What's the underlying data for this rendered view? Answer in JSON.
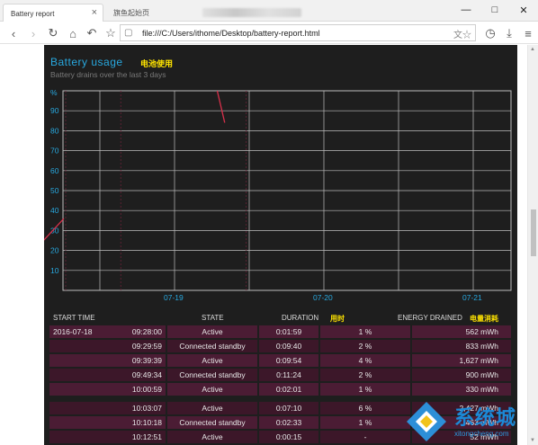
{
  "browser": {
    "active_tab": "Battery report",
    "inactive_tab": "旗鱼起始页",
    "address": "file:///C:/Users/ithome/Desktop/battery-report.html"
  },
  "section": {
    "title": "Battery usage",
    "title_cn": "电池使用",
    "subtitle": "Battery drains over the last 3 days"
  },
  "chart_data": {
    "type": "line",
    "ylabel": "%",
    "yticks": [
      "90",
      "80",
      "70",
      "60",
      "50",
      "40",
      "30",
      "20",
      "10"
    ],
    "ylim": [
      0,
      100
    ],
    "xticks": [
      "07-19",
      "07-20",
      "07-21"
    ],
    "grid": true,
    "series": [
      {
        "x": [
          0.0,
          0.03
        ],
        "y": [
          36,
          18
        ]
      },
      {
        "x": [
          1.28,
          1.33
        ],
        "y": [
          100,
          84
        ]
      }
    ]
  },
  "table": {
    "headers": {
      "start": "START TIME",
      "state": "STATE",
      "duration": "DURATION",
      "duration_cn": "用时",
      "energy": "ENERGY DRAINED",
      "energy_cn": "电量消耗"
    },
    "rows": [
      {
        "date": "2016-07-18",
        "time": "09:28:00",
        "state": "Active",
        "duration": "0:01:59",
        "pct": "1 %",
        "mwh": "562 mWh"
      },
      {
        "date": "",
        "time": "09:29:59",
        "state": "Connected standby",
        "duration": "0:09:40",
        "pct": "2 %",
        "mwh": "833 mWh"
      },
      {
        "date": "",
        "time": "09:39:39",
        "state": "Active",
        "duration": "0:09:54",
        "pct": "4 %",
        "mwh": "1,627 mWh"
      },
      {
        "date": "",
        "time": "09:49:34",
        "state": "Connected standby",
        "duration": "0:11:24",
        "pct": "2 %",
        "mwh": "900 mWh"
      },
      {
        "date": "",
        "time": "10:00:59",
        "state": "Active",
        "duration": "0:02:01",
        "pct": "1 %",
        "mwh": "330 mWh"
      },
      {
        "date": "",
        "time": "10:03:07",
        "state": "Active",
        "duration": "0:07:10",
        "pct": "6 %",
        "mwh": "2,427 mWh"
      },
      {
        "date": "",
        "time": "10:10:18",
        "state": "Connected standby",
        "duration": "0:02:33",
        "pct": "1 %",
        "mwh": "463 mWh"
      },
      {
        "date": "",
        "time": "10:12:51",
        "state": "Active",
        "duration": "0:00:15",
        "pct": "-",
        "mwh": "52 mWh"
      }
    ]
  },
  "watermark": {
    "brand": "系统城",
    "site": "xitongcheng.com"
  }
}
